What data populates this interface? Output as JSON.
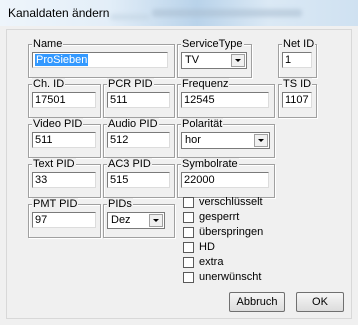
{
  "window": {
    "title": "Kanaldaten ändern"
  },
  "fields": {
    "name": {
      "label": "Name",
      "value": "ProSieben"
    },
    "service_type": {
      "label": "ServiceType",
      "value": "TV"
    },
    "net_id": {
      "label": "Net ID",
      "value": "1"
    },
    "ch_id": {
      "label": "Ch. ID",
      "value": "17501"
    },
    "pcr_pid": {
      "label": "PCR PID",
      "value": "511"
    },
    "frequenz": {
      "label": "Frequenz",
      "value": "12545"
    },
    "ts_id": {
      "label": "TS ID",
      "value": "1107"
    },
    "video_pid": {
      "label": "Video PID",
      "value": "511"
    },
    "audio_pid": {
      "label": "Audio PID",
      "value": "512"
    },
    "polaritaet": {
      "label": "Polarität",
      "value": "hor"
    },
    "text_pid": {
      "label": "Text PID",
      "value": "33"
    },
    "ac3_pid": {
      "label": "AC3 PID",
      "value": "515"
    },
    "symbolrate": {
      "label": "Symbolrate",
      "value": "22000"
    },
    "pmt_pid": {
      "label": "PMT PID",
      "value": "97"
    },
    "pids": {
      "label": "PIDs",
      "value": "Dez"
    }
  },
  "checkboxes": [
    {
      "label": "verschlüsselt",
      "checked": false
    },
    {
      "label": "gesperrt",
      "checked": false
    },
    {
      "label": "überspringen",
      "checked": false
    },
    {
      "label": "HD",
      "checked": false
    },
    {
      "label": "extra",
      "checked": false
    },
    {
      "label": "unerwünscht",
      "checked": false
    }
  ],
  "buttons": {
    "cancel": "Abbruch",
    "ok": "OK"
  }
}
